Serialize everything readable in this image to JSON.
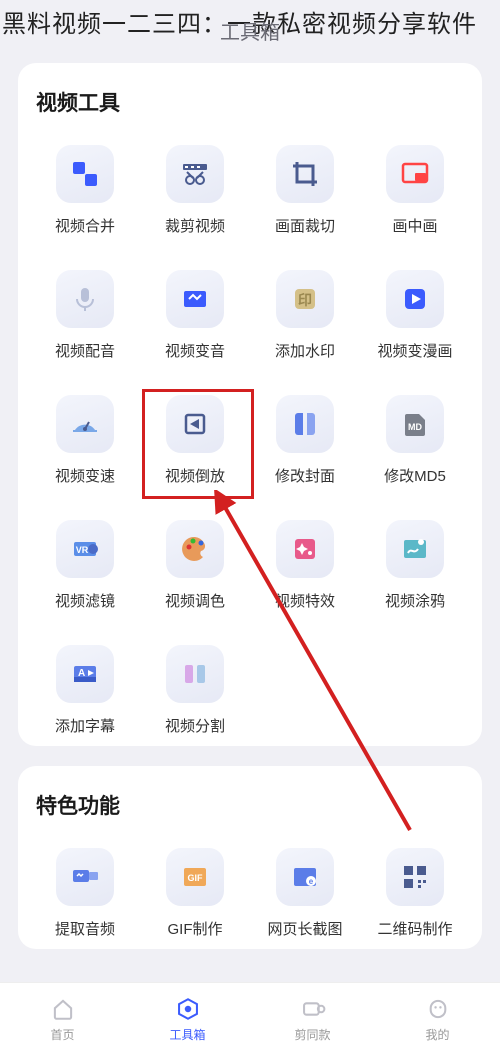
{
  "banner": "黑料视频一二三四：一款私密视频分享软件",
  "page_title": "工具箱",
  "sections": {
    "video_tools": {
      "title": "视频工具",
      "items": [
        {
          "label": "视频合并",
          "icon": "merge"
        },
        {
          "label": "裁剪视频",
          "icon": "trim"
        },
        {
          "label": "画面裁切",
          "icon": "crop"
        },
        {
          "label": "画中画",
          "icon": "pip"
        },
        {
          "label": "视频配音",
          "icon": "dub"
        },
        {
          "label": "视频变音",
          "icon": "voice"
        },
        {
          "label": "添加水印",
          "icon": "watermark"
        },
        {
          "label": "视频变漫画",
          "icon": "cartoon"
        },
        {
          "label": "视频变速",
          "icon": "speed"
        },
        {
          "label": "视频倒放",
          "icon": "reverse",
          "highlighted": true
        },
        {
          "label": "修改封面",
          "icon": "cover"
        },
        {
          "label": "修改MD5",
          "icon": "md5"
        },
        {
          "label": "视频滤镜",
          "icon": "filter"
        },
        {
          "label": "视频调色",
          "icon": "color"
        },
        {
          "label": "视频特效",
          "icon": "fx"
        },
        {
          "label": "视频涂鸦",
          "icon": "doodle"
        },
        {
          "label": "添加字幕",
          "icon": "subtitle"
        },
        {
          "label": "视频分割",
          "icon": "split"
        }
      ]
    },
    "featured": {
      "title": "特色功能",
      "items": [
        {
          "label": "提取音频",
          "icon": "extract-audio"
        },
        {
          "label": "GIF制作",
          "icon": "gif"
        },
        {
          "label": "网页长截图",
          "icon": "longshot"
        },
        {
          "label": "二维码制作",
          "icon": "qrcode"
        }
      ]
    }
  },
  "nav": [
    {
      "label": "首页",
      "icon": "home"
    },
    {
      "label": "工具箱",
      "icon": "toolbox",
      "active": true
    },
    {
      "label": "剪同款",
      "icon": "template"
    },
    {
      "label": "我的",
      "icon": "profile"
    }
  ],
  "colors": {
    "accent": "#3b5bfd",
    "highlight": "#d32020"
  }
}
